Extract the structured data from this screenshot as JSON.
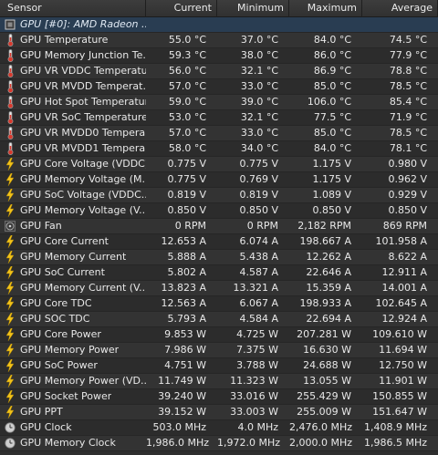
{
  "columns": [
    "Sensor",
    "Current",
    "Minimum",
    "Maximum",
    "Average"
  ],
  "colors": {
    "group_bg": "#293d52",
    "temp_icon": "#d9382c",
    "volt_icon": "#f2c21a"
  },
  "group": {
    "label": "GPU [#0]: AMD Radeon ...",
    "icon": "chip-icon"
  },
  "rows": [
    {
      "icon": "thermometer-icon",
      "label": "GPU Temperature",
      "current": "55.0 °C",
      "minimum": "37.0 °C",
      "maximum": "84.0 °C",
      "average": "74.5 °C"
    },
    {
      "icon": "thermometer-icon",
      "label": "GPU Memory Junction Te...",
      "current": "59.3 °C",
      "minimum": "38.0 °C",
      "maximum": "86.0 °C",
      "average": "77.9 °C"
    },
    {
      "icon": "thermometer-icon",
      "label": "GPU VR VDDC Temperature",
      "current": "56.0 °C",
      "minimum": "32.1 °C",
      "maximum": "86.9 °C",
      "average": "78.8 °C"
    },
    {
      "icon": "thermometer-icon",
      "label": "GPU VR MVDD Temperat...",
      "current": "57.0 °C",
      "minimum": "33.0 °C",
      "maximum": "85.0 °C",
      "average": "78.5 °C"
    },
    {
      "icon": "thermometer-icon",
      "label": "GPU Hot Spot Temperature",
      "current": "59.0 °C",
      "minimum": "39.0 °C",
      "maximum": "106.0 °C",
      "average": "85.4 °C"
    },
    {
      "icon": "thermometer-icon",
      "label": "GPU VR SoC Temperature",
      "current": "53.0 °C",
      "minimum": "32.1 °C",
      "maximum": "77.5 °C",
      "average": "71.9 °C"
    },
    {
      "icon": "thermometer-icon",
      "label": "GPU VR MVDD0 Tempera...",
      "current": "57.0 °C",
      "minimum": "33.0 °C",
      "maximum": "85.0 °C",
      "average": "78.5 °C"
    },
    {
      "icon": "thermometer-icon",
      "label": "GPU VR MVDD1 Tempera...",
      "current": "58.0 °C",
      "minimum": "34.0 °C",
      "maximum": "84.0 °C",
      "average": "78.1 °C"
    },
    {
      "icon": "lightning-icon",
      "label": "GPU Core Voltage (VDDC)",
      "current": "0.775 V",
      "minimum": "0.775 V",
      "maximum": "1.175 V",
      "average": "0.980 V"
    },
    {
      "icon": "lightning-icon",
      "label": "GPU Memory Voltage (M...",
      "current": "0.775 V",
      "minimum": "0.769 V",
      "maximum": "1.175 V",
      "average": "0.962 V"
    },
    {
      "icon": "lightning-icon",
      "label": "GPU SoC Voltage (VDDC...",
      "current": "0.819 V",
      "minimum": "0.819 V",
      "maximum": "1.089 V",
      "average": "0.929 V"
    },
    {
      "icon": "lightning-icon",
      "label": "GPU Memory Voltage (V...",
      "current": "0.850 V",
      "minimum": "0.850 V",
      "maximum": "0.850 V",
      "average": "0.850 V"
    },
    {
      "icon": "fan-icon",
      "label": "GPU Fan",
      "current": "0 RPM",
      "minimum": "0 RPM",
      "maximum": "2,182 RPM",
      "average": "869 RPM"
    },
    {
      "icon": "lightning-icon",
      "label": "GPU Core Current",
      "current": "12.653 A",
      "minimum": "6.074 A",
      "maximum": "198.667 A",
      "average": "101.958 A"
    },
    {
      "icon": "lightning-icon",
      "label": "GPU Memory Current",
      "current": "5.888 A",
      "minimum": "5.438 A",
      "maximum": "12.262 A",
      "average": "8.622 A"
    },
    {
      "icon": "lightning-icon",
      "label": "GPU SoC Current",
      "current": "5.802 A",
      "minimum": "4.587 A",
      "maximum": "22.646 A",
      "average": "12.911 A"
    },
    {
      "icon": "lightning-icon",
      "label": "GPU Memory Current (V...",
      "current": "13.823 A",
      "minimum": "13.321 A",
      "maximum": "15.359 A",
      "average": "14.001 A"
    },
    {
      "icon": "lightning-icon",
      "label": "GPU Core TDC",
      "current": "12.563 A",
      "minimum": "6.067 A",
      "maximum": "198.933 A",
      "average": "102.645 A"
    },
    {
      "icon": "lightning-icon",
      "label": "GPU SOC TDC",
      "current": "5.793 A",
      "minimum": "4.584 A",
      "maximum": "22.694 A",
      "average": "12.924 A"
    },
    {
      "icon": "lightning-icon",
      "label": "GPU Core Power",
      "current": "9.853 W",
      "minimum": "4.725 W",
      "maximum": "207.281 W",
      "average": "109.610 W"
    },
    {
      "icon": "lightning-icon",
      "label": "GPU Memory Power",
      "current": "7.986 W",
      "minimum": "7.375 W",
      "maximum": "16.630 W",
      "average": "11.694 W"
    },
    {
      "icon": "lightning-icon",
      "label": "GPU SoC Power",
      "current": "4.751 W",
      "minimum": "3.788 W",
      "maximum": "24.688 W",
      "average": "12.750 W"
    },
    {
      "icon": "lightning-icon",
      "label": "GPU Memory Power (VD...",
      "current": "11.749 W",
      "minimum": "11.323 W",
      "maximum": "13.055 W",
      "average": "11.901 W"
    },
    {
      "icon": "lightning-icon",
      "label": "GPU Socket Power",
      "current": "39.240 W",
      "minimum": "33.016 W",
      "maximum": "255.429 W",
      "average": "150.855 W"
    },
    {
      "icon": "lightning-icon",
      "label": "GPU PPT",
      "current": "39.152 W",
      "minimum": "33.003 W",
      "maximum": "255.009 W",
      "average": "151.647 W"
    },
    {
      "icon": "clock-icon",
      "label": "GPU Clock",
      "current": "503.0 MHz",
      "minimum": "4.0 MHz",
      "maximum": "2,476.0 MHz",
      "average": "1,408.9 MHz"
    },
    {
      "icon": "clock-icon",
      "label": "GPU Memory Clock",
      "current": "1,986.0 MHz",
      "minimum": "1,972.0 MHz",
      "maximum": "2,000.0 MHz",
      "average": "1,986.5 MHz"
    }
  ]
}
